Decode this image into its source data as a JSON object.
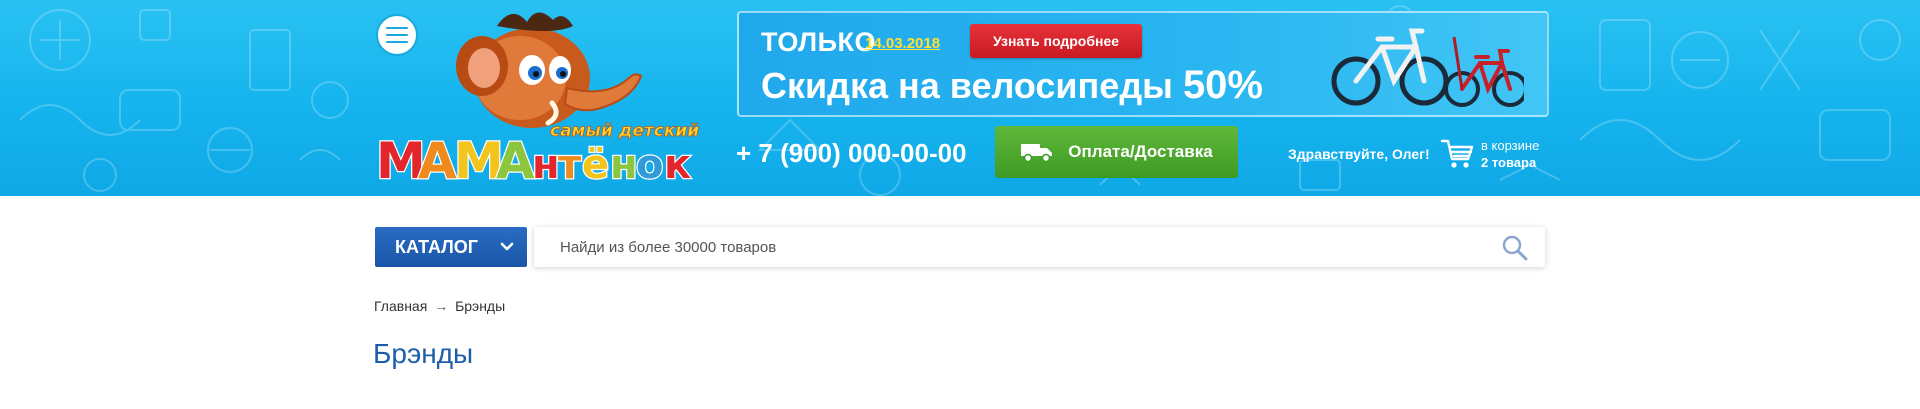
{
  "header": {
    "logo": {
      "tagline": "самый детский",
      "brand": "МАМАнтёнок"
    },
    "promo": {
      "only_label": "ТОЛЬКО",
      "date": "14.03.2018",
      "more_button": "Узнать подробнее",
      "headline": "Скидка на велосипеды",
      "discount": "50%"
    },
    "phone": "+ 7 (900) 000-00-00",
    "delivery_button": "Оплата/Доставка",
    "greeting": "Здравствуйте, Олег!",
    "cart": {
      "label": "в корзине",
      "count": "2 товара"
    }
  },
  "search": {
    "catalog_button": "КАТАЛОГ",
    "placeholder": "Найди из более 30000 товаров"
  },
  "breadcrumb": {
    "home": "Главная",
    "separator": "→",
    "current": "Брэнды"
  },
  "page_title": "Брэнды",
  "colors": {
    "header_blue": "#15b4ee",
    "promo_red": "#d4232b",
    "delivery_green": "#4aa82e",
    "catalog_blue": "#1f5fb2",
    "title_blue": "#1d5ea9",
    "date_yellow": "#ffe033"
  },
  "icons": [
    "menu-icon",
    "truck-icon",
    "cart-icon",
    "search-icon",
    "chevron-down-icon"
  ]
}
